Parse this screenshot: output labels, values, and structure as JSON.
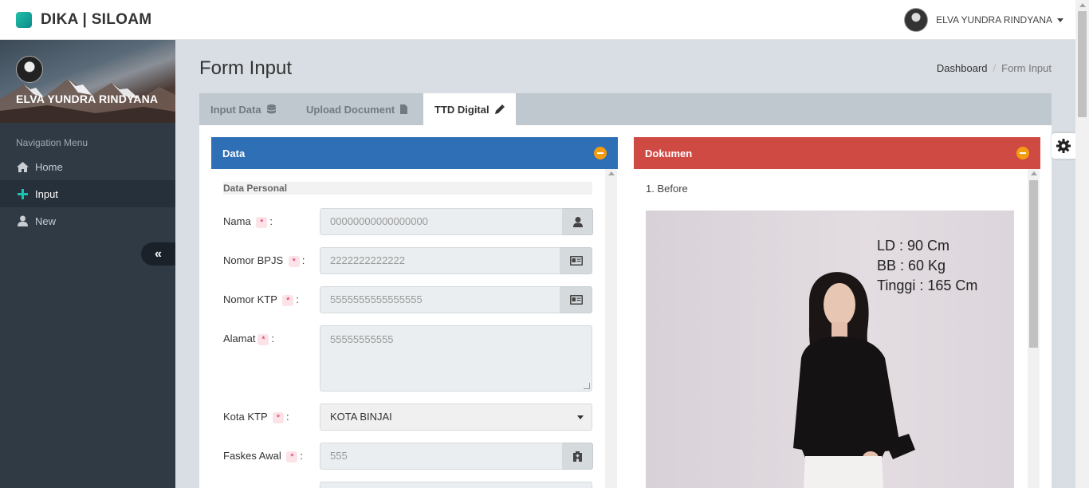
{
  "app": {
    "brand": "DIKA | SILOAM",
    "user_name": "ELVA YUNDRA RINDYANA"
  },
  "sidebar": {
    "profile_name": "ELVA YUNDRA RINDYANA",
    "nav_header": "Navigation Menu",
    "items": [
      {
        "label": "Home",
        "icon": "home-icon"
      },
      {
        "label": "Input",
        "icon": "plus-icon",
        "active": true
      },
      {
        "label": "New",
        "icon": "user-icon"
      }
    ],
    "collapse_icon": "double-chevron-left-icon"
  },
  "page": {
    "title": "Form Input",
    "breadcrumb": [
      "Dashboard",
      "Form Input"
    ]
  },
  "tabs": [
    {
      "label": "Input Data",
      "icon": "database-icon"
    },
    {
      "label": "Upload Document",
      "icon": "file-icon"
    },
    {
      "label": "TTD Digital",
      "icon": "pencil-icon",
      "active": true
    }
  ],
  "data_panel": {
    "title": "Data",
    "section": "Data Personal",
    "fields": {
      "nama": {
        "label": "Nama",
        "value": "00000000000000000",
        "icon": "user-icon"
      },
      "bpjs": {
        "label": "Nomor BPJS",
        "value": "2222222222222",
        "icon": "id-card-icon"
      },
      "ktp": {
        "label": "Nomor KTP",
        "value": "5555555555555555",
        "icon": "id-card-icon"
      },
      "alamat": {
        "label": "Alamat",
        "value": "55555555555"
      },
      "kota": {
        "label": "Kota KTP",
        "value": "KOTA BINJAI"
      },
      "faskes": {
        "label": "Faskes Awal",
        "value": "555",
        "icon": "hospital-icon"
      }
    },
    "required_mark": "*",
    "colon": ":"
  },
  "doc_panel": {
    "title": "Dokumen",
    "item_label": "1. Before",
    "photo_text": [
      "LD : 90 Cm",
      "BB : 60 Kg",
      "Tinggi : 165 Cm"
    ]
  },
  "colors": {
    "data_header": "#2e6fb5",
    "doc_header": "#d04a44",
    "toggle": "#f39c12"
  }
}
